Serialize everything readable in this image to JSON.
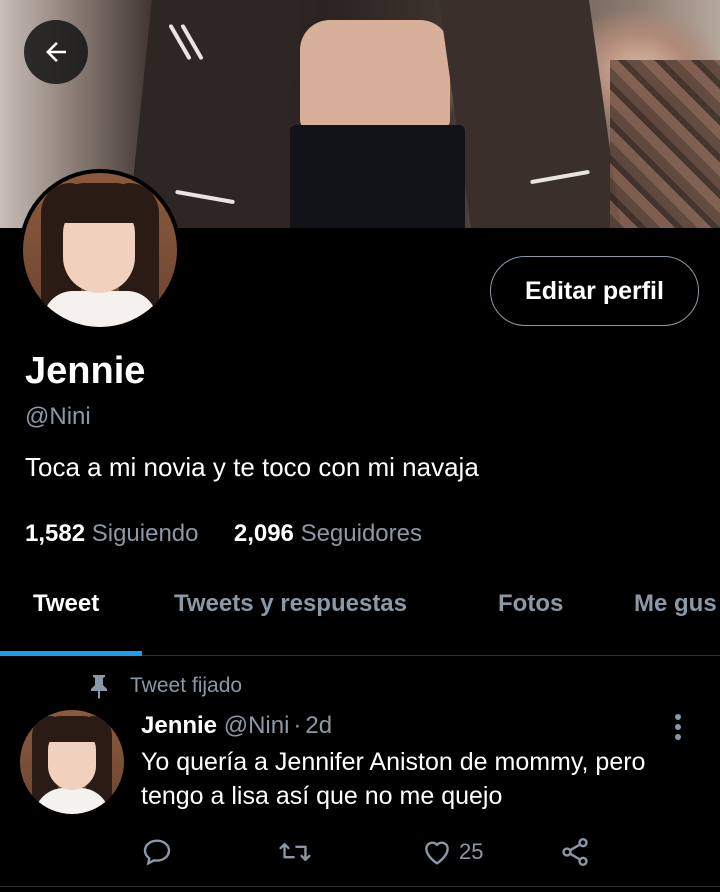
{
  "header": {
    "back_icon": "arrow-left-icon"
  },
  "profile": {
    "name": "Jennie",
    "handle": "@Nini",
    "bio": "Toca a mi novia y te toco con mi navaja",
    "edit_label": "Editar perfil",
    "following_count": "1,582",
    "following_label": "Siguiendo",
    "followers_count": "2,096",
    "followers_label": "Seguidores"
  },
  "tabs": [
    {
      "label": "Tweet",
      "active": true
    },
    {
      "label": "Tweets y respuestas",
      "active": false
    },
    {
      "label": "Fotos",
      "active": false
    },
    {
      "label": "Me gus",
      "active": false
    }
  ],
  "pinned_tweet": {
    "pinned_label": "Tweet fijado",
    "author_name": "Jennie",
    "author_handle": "@Nini",
    "separator": "·",
    "time": "2d",
    "text": "Yo quería a Jennifer Aniston de mommy, pero tengo a lisa así que no me quejo",
    "reply_count": "",
    "retweet_count": "",
    "like_count": "25"
  },
  "colors": {
    "background": "#000000",
    "accent": "#1d9bf0",
    "secondary_text": "#8b98a5"
  }
}
